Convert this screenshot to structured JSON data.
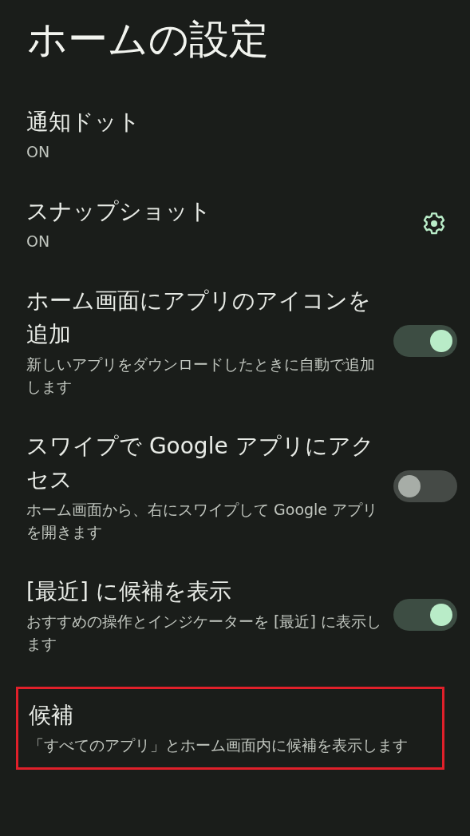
{
  "title": "ホームの設定",
  "items": [
    {
      "kind": "plain",
      "title": "通知ドット",
      "summary": "ON",
      "highlighted": false
    },
    {
      "kind": "gear",
      "title": "スナップショット",
      "summary": "ON",
      "highlighted": false
    },
    {
      "kind": "toggle",
      "title": "ホーム画面にアプリのアイコンを追加",
      "summary": "新しいアプリをダウンロードしたときに自動で追加します",
      "on": true,
      "highlighted": false
    },
    {
      "kind": "toggle",
      "title": "スワイプで Google アプリにアクセス",
      "summary": "ホーム画面から、右にスワイプして Google アプリを開きます",
      "on": false,
      "highlighted": false
    },
    {
      "kind": "toggle",
      "title": "[最近] に候補を表示",
      "summary": "おすすめの操作とインジケーターを [最近] に表示します",
      "on": true,
      "highlighted": false
    },
    {
      "kind": "plain",
      "title": "候補",
      "summary": "「すべてのアプリ」とホーム画面内に候補を表示します",
      "highlighted": true
    }
  ]
}
